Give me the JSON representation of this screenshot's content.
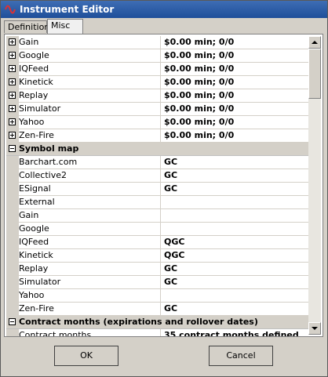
{
  "window": {
    "title": "Instrument Editor"
  },
  "tabs": [
    {
      "label": "Definition"
    },
    {
      "label": "Misc"
    }
  ],
  "providers": [
    {
      "name": "Gain",
      "value": "$0.00 min;  0/0"
    },
    {
      "name": "Google",
      "value": "$0.00 min;  0/0"
    },
    {
      "name": "IQFeed",
      "value": "$0.00 min;  0/0"
    },
    {
      "name": "Kinetick",
      "value": "$0.00 min;  0/0"
    },
    {
      "name": "Replay",
      "value": "$0.00 min;  0/0"
    },
    {
      "name": "Simulator",
      "value": "$0.00 min;  0/0"
    },
    {
      "name": "Yahoo",
      "value": "$0.00 min;  0/0"
    },
    {
      "name": "Zen-Fire",
      "value": "$0.00 min;  0/0"
    }
  ],
  "symbol_map": {
    "label": "Symbol map",
    "items": [
      {
        "name": "Barchart.com",
        "value": "GC"
      },
      {
        "name": "Collective2",
        "value": "GC"
      },
      {
        "name": "ESignal",
        "value": "GC"
      },
      {
        "name": "External",
        "value": ""
      },
      {
        "name": "Gain",
        "value": ""
      },
      {
        "name": "Google",
        "value": ""
      },
      {
        "name": "IQFeed",
        "value": "QGC"
      },
      {
        "name": "Kinetick",
        "value": "QGC"
      },
      {
        "name": "Replay",
        "value": "GC"
      },
      {
        "name": "Simulator",
        "value": "GC"
      },
      {
        "name": "Yahoo",
        "value": ""
      },
      {
        "name": "Zen-Fire",
        "value": "GC"
      }
    ]
  },
  "contract_months": {
    "label": "Contract months (expirations and rollover dates)",
    "name": "Contract months",
    "value": "35 contract months defined"
  },
  "buttons": {
    "ok": "OK",
    "cancel": "Cancel"
  }
}
